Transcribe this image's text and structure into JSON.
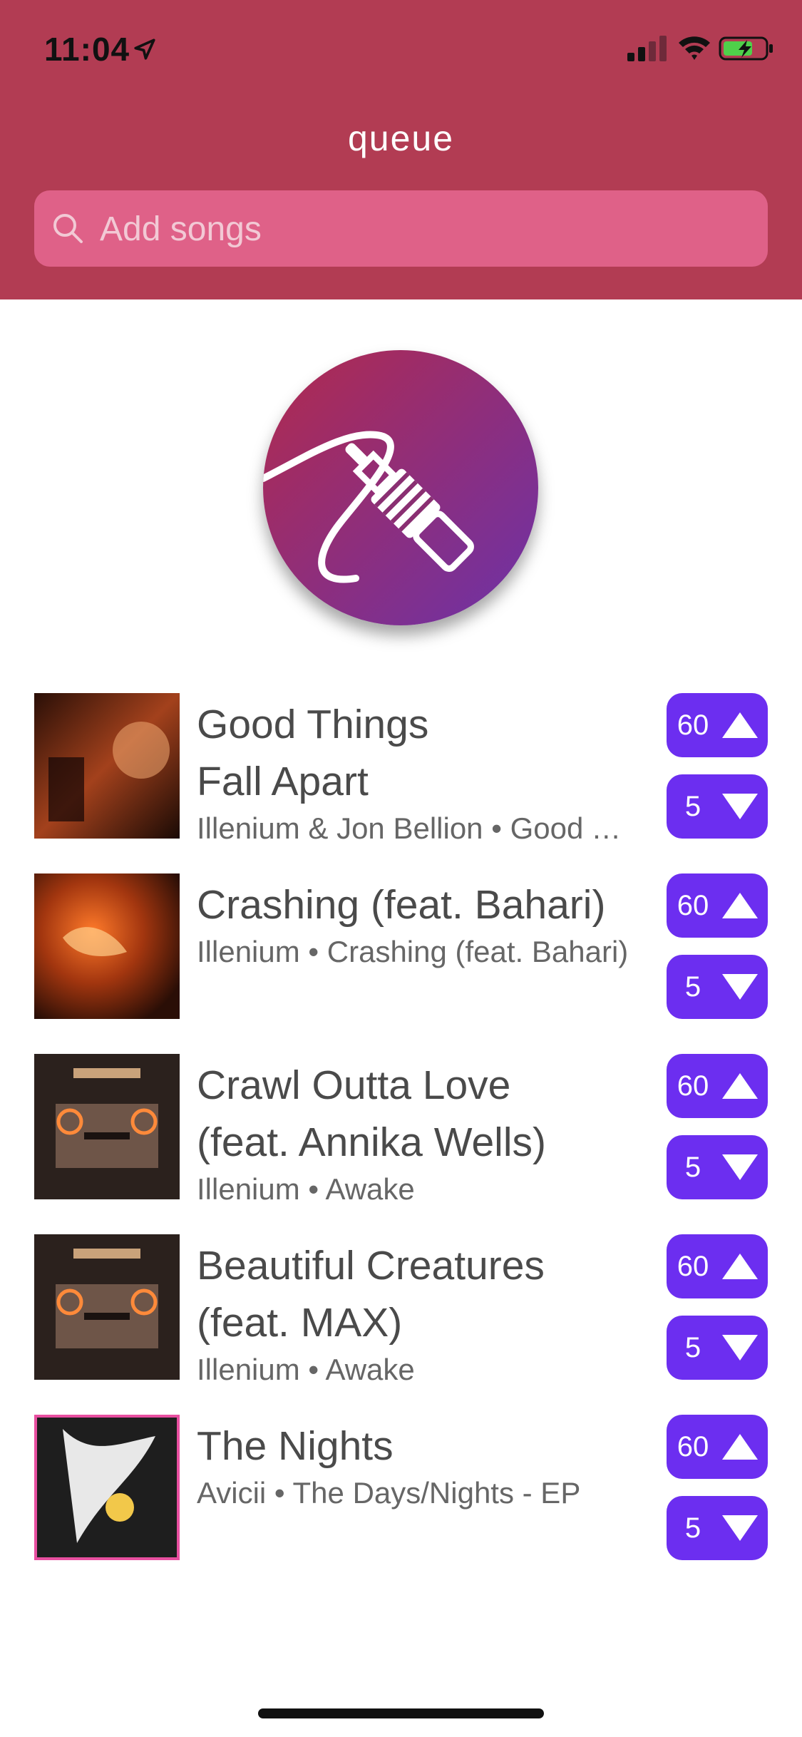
{
  "status_bar": {
    "time": "11:04"
  },
  "header": {
    "title": "queue"
  },
  "search": {
    "placeholder": "Add songs"
  },
  "colors": {
    "header_bg": "#b23c53",
    "search_bg": "#df6188",
    "vote_button": "#6c2ef0",
    "logo_gradient_start": "#b22a4d",
    "logo_gradient_end": "#6c32a8"
  },
  "songs": [
    {
      "title_line1": "Good Things",
      "title_line2": "Fall Apart",
      "subtitle": "Illenium & Jon Bellion • Good Things Fall Apart",
      "upvotes": "60",
      "downvotes": "5"
    },
    {
      "title_line1": "Crashing (feat. Bahari)",
      "title_line2": "",
      "subtitle": "Illenium • Crashing (feat. Bahari)",
      "upvotes": "60",
      "downvotes": "5"
    },
    {
      "title_line1": "Crawl Outta Love",
      "title_line2": "(feat. Annika Wells)",
      "subtitle": "Illenium • Awake",
      "upvotes": "60",
      "downvotes": "5"
    },
    {
      "title_line1": "Beautiful Creatures",
      "title_line2": "(feat. MAX)",
      "subtitle": "Illenium • Awake",
      "upvotes": "60",
      "downvotes": "5"
    },
    {
      "title_line1": "The Nights",
      "title_line2": "",
      "subtitle": "Avicii • The Days/Nights - EP",
      "upvotes": "60",
      "downvotes": "5"
    }
  ],
  "icons": [
    "location-arrow-icon",
    "signal-icon",
    "wifi-icon",
    "battery-charging-icon",
    "search-icon",
    "audio-jack-icon",
    "upvote-triangle-icon",
    "downvote-triangle-icon"
  ]
}
